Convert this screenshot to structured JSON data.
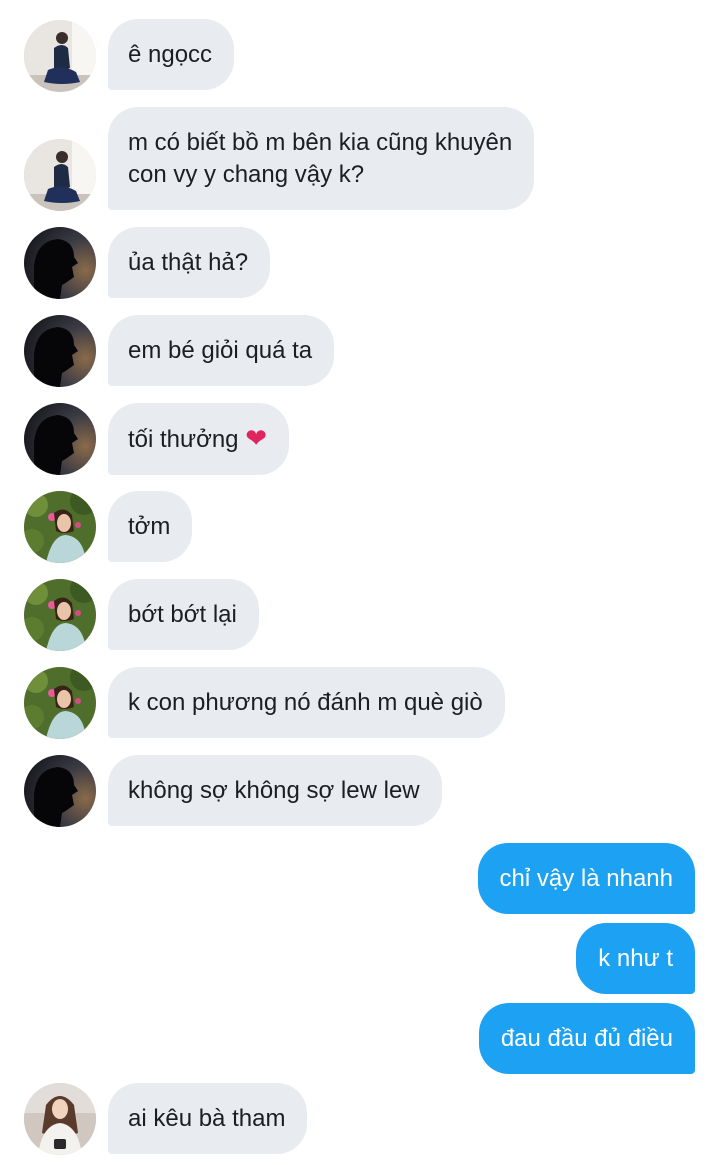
{
  "colors": {
    "incoming_bubble": "#e8ecf0",
    "outgoing_bubble": "#1da1f2",
    "incoming_text": "#1c1e21",
    "outgoing_text": "#ffffff",
    "heart": "#e0245e"
  },
  "messages": [
    {
      "direction": "in",
      "avatar": "user-avatar-dark-dress",
      "text": "ê ngọcc"
    },
    {
      "direction": "in",
      "avatar": "user-avatar-dark-dress",
      "text": "m có biết bồ m bên kia cũng khuyên\ncon vy y chang vậy k?"
    },
    {
      "direction": "in",
      "avatar": "user-avatar-silhouette",
      "text": "ủa thật hả?"
    },
    {
      "direction": "in",
      "avatar": "user-avatar-silhouette",
      "text": "em bé giỏi quá ta"
    },
    {
      "direction": "in",
      "avatar": "user-avatar-silhouette",
      "text": "tối thưởng",
      "emoji": "❤"
    },
    {
      "direction": "in",
      "avatar": "user-avatar-garden",
      "text": "tởm"
    },
    {
      "direction": "in",
      "avatar": "user-avatar-garden",
      "text": "bớt bớt lại"
    },
    {
      "direction": "in",
      "avatar": "user-avatar-garden",
      "text": "k con phương nó đánh m què giò"
    },
    {
      "direction": "in",
      "avatar": "user-avatar-silhouette",
      "text": "không sợ không sợ lew lew"
    },
    {
      "direction": "out",
      "text": "chỉ vậy là nhanh"
    },
    {
      "direction": "out",
      "text": "k như t"
    },
    {
      "direction": "out",
      "text": "đau đầu đủ điều"
    },
    {
      "direction": "in",
      "avatar": "user-avatar-white-top",
      "text": "ai kêu bà tham"
    }
  ]
}
